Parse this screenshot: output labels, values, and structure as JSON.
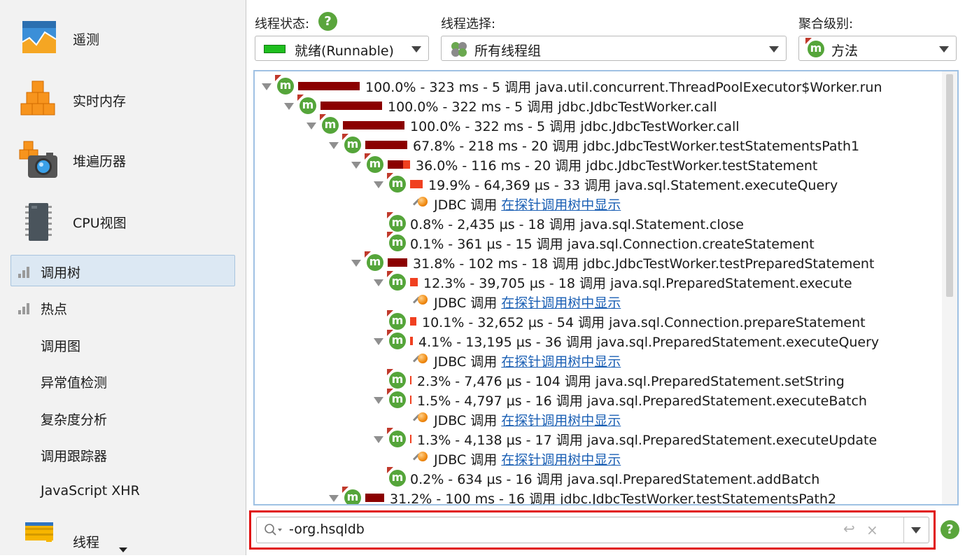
{
  "sidebar": {
    "items": [
      {
        "label": "遥测",
        "icon": "telemetry-chart-icon"
      },
      {
        "label": "实时内存",
        "icon": "live-memory-cubes-icon"
      },
      {
        "label": "堆遍历器",
        "icon": "heap-walker-camera-icon"
      },
      {
        "label": "CPU视图",
        "icon": "cpu-chip-icon"
      },
      {
        "label": "调用树",
        "icon": "bar-chart-icon"
      },
      {
        "label": "热点",
        "icon": "bar-chart-icon"
      },
      {
        "label": "调用图"
      },
      {
        "label": "异常值检测"
      },
      {
        "label": "复杂度分析"
      },
      {
        "label": "调用跟踪器"
      },
      {
        "label": "JavaScript XHR"
      },
      {
        "label": "线程",
        "icon": "threads-icon"
      }
    ],
    "selected": "调用树"
  },
  "toolbar": {
    "thread_state_label": "线程状态:",
    "thread_state_value": "就绪(Runnable)",
    "thread_select_label": "线程选择:",
    "thread_select_value": "所有线程组",
    "aggregation_label": "聚合级别:",
    "aggregation_value": "方法",
    "help_glyph": "?",
    "colors": {
      "runnable": "#1fbf1f",
      "method_icon": "#55a53a",
      "bar_dark": "#8b0000",
      "bar_red": "#f04020"
    }
  },
  "tree": {
    "method_glyph": "m",
    "rows": [
      {
        "type": "method",
        "text": "100.0% - 323 ms - 5 调用 java.util.concurrent.ThreadPoolExecutor$Worker.run",
        "bar": 1.0
      },
      {
        "type": "method",
        "text": "100.0% - 322 ms - 5 调用 jdbc.JdbcTestWorker.call",
        "bar": 1.0
      },
      {
        "type": "method",
        "text": "100.0% - 322 ms - 5 调用 jdbc.JdbcTestWorker.call",
        "bar": 1.0
      },
      {
        "type": "method",
        "text": "67.8% - 218 ms - 20 调用 jdbc.JdbcTestWorker.testStatementsPath1",
        "bar": 0.678
      },
      {
        "type": "method",
        "text": "36.0% - 116 ms - 20 调用 jdbc.JdbcTestWorker.testStatement",
        "bar": 0.36
      },
      {
        "type": "method",
        "text": "19.9% - 64,369 µs - 33 调用 java.sql.Statement.executeQuery",
        "bar": 0.199
      },
      {
        "type": "probe",
        "label": "JDBC 调用",
        "link": "在探针调用树中显示"
      },
      {
        "type": "method",
        "text": "0.8% - 2,435 µs - 18 调用 java.sql.Statement.close",
        "bar": 0.008
      },
      {
        "type": "method",
        "text": "0.1% - 361 µs - 15 调用 java.sql.Connection.createStatement",
        "bar": 0.001
      },
      {
        "type": "method",
        "text": "31.8% - 102 ms - 18 调用 jdbc.JdbcTestWorker.testPreparedStatement",
        "bar": 0.318
      },
      {
        "type": "method",
        "text": "12.3% - 39,705 µs - 18 调用 java.sql.PreparedStatement.execute",
        "bar": 0.123
      },
      {
        "type": "probe",
        "label": "JDBC 调用",
        "link": "在探针调用树中显示"
      },
      {
        "type": "method",
        "text": "10.1% - 32,652 µs - 54 调用 java.sql.Connection.prepareStatement",
        "bar": 0.101
      },
      {
        "type": "method",
        "text": "4.1% - 13,195 µs - 36 调用 java.sql.PreparedStatement.executeQuery",
        "bar": 0.041
      },
      {
        "type": "probe",
        "label": "JDBC 调用",
        "link": "在探针调用树中显示"
      },
      {
        "type": "method",
        "text": "2.3% - 7,476 µs - 104 调用 java.sql.PreparedStatement.setString",
        "bar": 0.023
      },
      {
        "type": "method",
        "text": "1.5% - 4,797 µs - 16 调用 java.sql.PreparedStatement.executeBatch",
        "bar": 0.015
      },
      {
        "type": "probe",
        "label": "JDBC 调用",
        "link": "在探针调用树中显示"
      },
      {
        "type": "method",
        "text": "1.3% - 4,138 µs - 17 调用 java.sql.PreparedStatement.executeUpdate",
        "bar": 0.013
      },
      {
        "type": "probe",
        "label": "JDBC 调用",
        "link": "在探针调用树中显示"
      },
      {
        "type": "method",
        "text": "0.2% - 634 µs - 16 调用 java.sql.PreparedStatement.addBatch",
        "bar": 0.002
      },
      {
        "type": "method",
        "text": "31.2% - 100 ms - 16 调用 jdbc.JdbcTestWorker.testStatementsPath2",
        "bar": 0.312
      }
    ]
  },
  "search": {
    "value": "-org.hsqldb",
    "clear_glyph": "×",
    "wrap_glyph": "↩"
  }
}
